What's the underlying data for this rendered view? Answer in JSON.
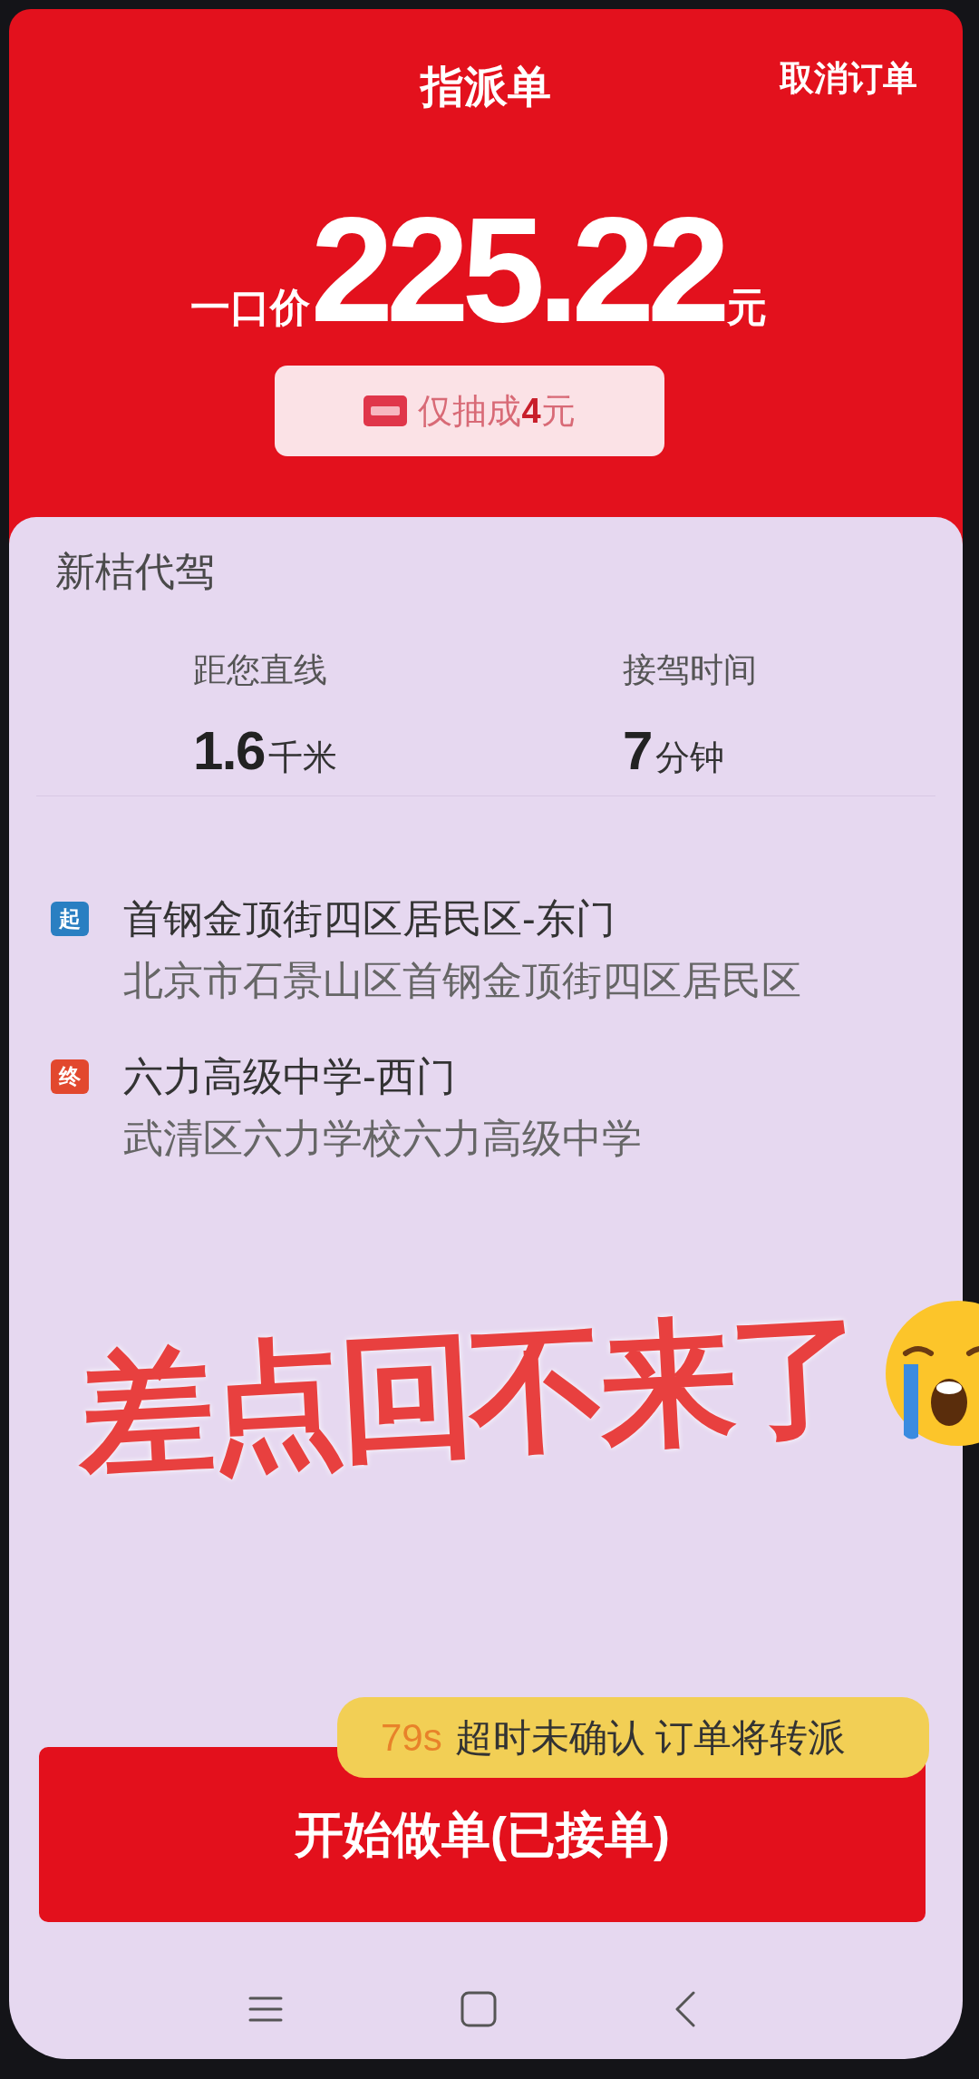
{
  "header": {
    "title": "指派单",
    "cancel_button": "取消订单"
  },
  "price": {
    "label": "一口价",
    "amount": "225.22",
    "unit": "元"
  },
  "commission_badge": {
    "text": "仅抽成**4**元"
  },
  "order": {
    "service": "新桔代驾",
    "stats": [
      {
        "label": "距您直线",
        "value": "1.6",
        "unit": "千米"
      },
      {
        "label": "接驾时间",
        "value": "7",
        "unit": "分钟"
      }
    ],
    "stops": [
      {
        "marker": "起",
        "color": "#2a7fc2",
        "name": "首钢金顶街四区居民区-东门",
        "address": "北京市石景山区首钢金顶街四区居民区"
      },
      {
        "marker": "终",
        "color": "#e2482e",
        "name": "六力高级中学-西门",
        "address": "武清区六力学校六力高级中学"
      }
    ]
  },
  "caption": {
    "text": "差点回不来了"
  },
  "timeout_notice": {
    "countdown": "79s",
    "message": "超时未确认 订单将转派"
  },
  "action_button": "开始做单(已接单)"
}
